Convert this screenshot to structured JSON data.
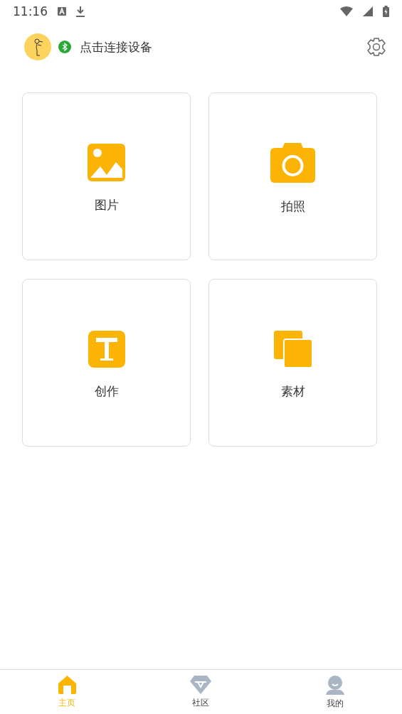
{
  "status_bar": {
    "time": "11:16"
  },
  "header": {
    "device_label": "点击连接设备",
    "bluetooth_on": true
  },
  "tiles": [
    {
      "kind": "image",
      "label": "图片"
    },
    {
      "kind": "camera",
      "label": "拍照"
    },
    {
      "kind": "text",
      "label": "创作"
    },
    {
      "kind": "copy",
      "label": "素材"
    }
  ],
  "tabs": [
    {
      "kind": "home",
      "label": "主页",
      "selected": true
    },
    {
      "kind": "gem",
      "label": "社区",
      "selected": false
    },
    {
      "kind": "user",
      "label": "我的",
      "selected": false
    }
  ]
}
